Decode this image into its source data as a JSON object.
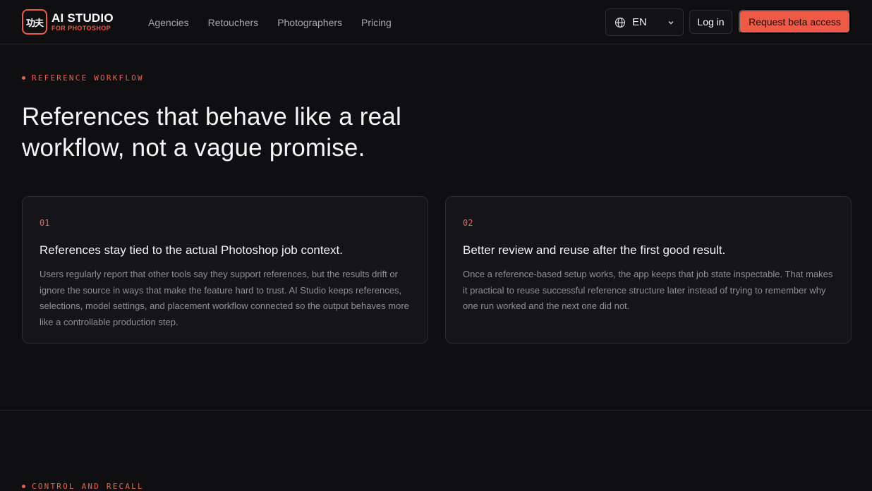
{
  "brand": {
    "mark": "功夫",
    "title": "AI STUDIO",
    "subtitle": "FOR PHOTOSHOP",
    "accent": "#ee5a45"
  },
  "nav": {
    "links": [
      "Agencies",
      "Retouchers",
      "Photographers",
      "Pricing"
    ],
    "language": "EN",
    "login_label": "Log in",
    "cta_label": "Request beta access"
  },
  "hero": {
    "eyebrow": "REFERENCE WORKFLOW",
    "headline": "References that behave like a real workflow, not a vague promise."
  },
  "cards": [
    {
      "number": "01",
      "title": "References stay tied to the actual Photoshop job context.",
      "body": "Users regularly report that other tools say they support references, but the results drift or ignore the source in ways that make the feature hard to trust. AI Studio keeps references, selections, model settings, and placement workflow connected so the output behaves more like a controllable production step."
    },
    {
      "number": "02",
      "title": "Better review and reuse after the first good result.",
      "body": "Once a reference-based setup works, the app keeps that job state inspectable. That makes it practical to reuse successful reference structure later instead of trying to remember why one run worked and the next one did not."
    }
  ],
  "next_section": {
    "eyebrow": "CONTROL AND RECALL"
  }
}
